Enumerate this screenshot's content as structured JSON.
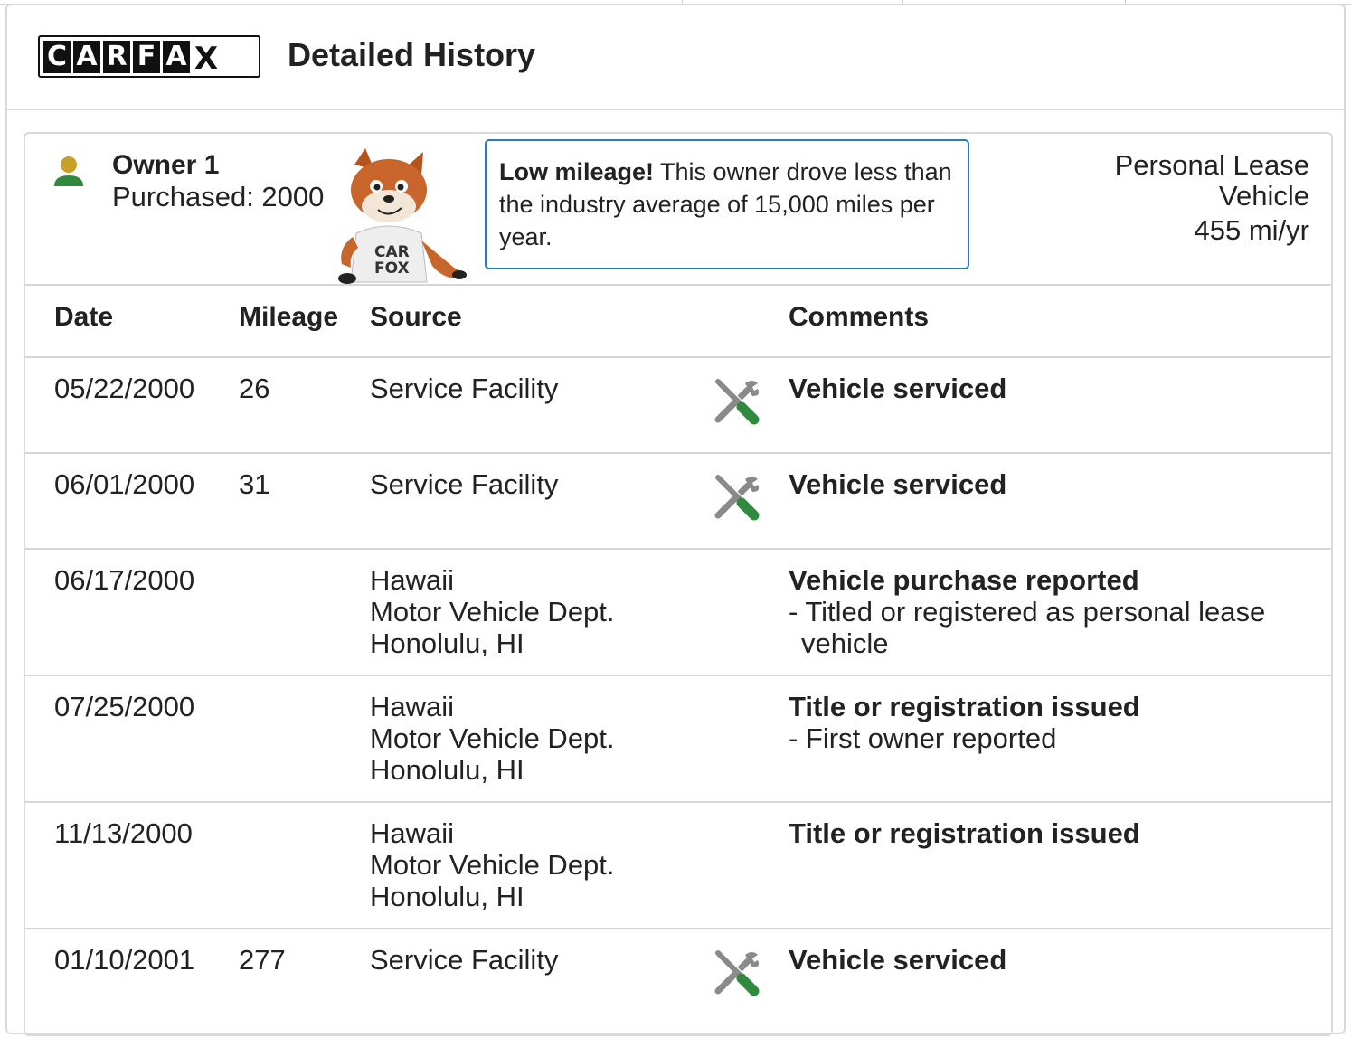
{
  "header": {
    "logo_letters": [
      "C",
      "A",
      "R",
      "F",
      "A",
      "X"
    ],
    "title": "Detailed History"
  },
  "owner": {
    "name": "Owner 1",
    "purchased": "Purchased: 2000",
    "callout_bold": "Low mileage!",
    "callout_text": " This owner drove less than the industry average of 15,000 miles per year.",
    "usage_type": "Personal Lease Vehicle",
    "miles_per_year": "455 mi/yr"
  },
  "table": {
    "columns": [
      "Date",
      "Mileage",
      "Source",
      "Comments"
    ],
    "rows": [
      {
        "date": "05/22/2000",
        "mileage": "26",
        "source": [
          "Service Facility"
        ],
        "icon": "service-wrench-icon",
        "comment_title": "Vehicle serviced",
        "comment_lines": []
      },
      {
        "date": "06/01/2000",
        "mileage": "31",
        "source": [
          "Service Facility"
        ],
        "icon": "service-wrench-icon",
        "comment_title": "Vehicle serviced",
        "comment_lines": []
      },
      {
        "date": "06/17/2000",
        "mileage": "",
        "source": [
          "Hawaii",
          "Motor Vehicle Dept.",
          "Honolulu, HI"
        ],
        "icon": "",
        "comment_title": "Vehicle purchase reported",
        "comment_lines": [
          "- Titled or registered as personal lease vehicle"
        ]
      },
      {
        "date": "07/25/2000",
        "mileage": "",
        "source": [
          "Hawaii",
          "Motor Vehicle Dept.",
          "Honolulu, HI"
        ],
        "icon": "",
        "comment_title": "Title or registration issued",
        "comment_lines": [
          "- First owner reported"
        ]
      },
      {
        "date": "11/13/2000",
        "mileage": "",
        "source": [
          "Hawaii",
          "Motor Vehicle Dept.",
          "Honolulu, HI"
        ],
        "icon": "",
        "comment_title": "Title or registration issued",
        "comment_lines": []
      },
      {
        "date": "01/10/2001",
        "mileage": "277",
        "source": [
          "Service Facility"
        ],
        "icon": "service-wrench-icon",
        "comment_title": "Vehicle serviced",
        "comment_lines": []
      }
    ]
  },
  "colors": {
    "accent_blue": "#2a78c6",
    "owner_icon_head": "#c8a028",
    "owner_icon_body": "#2e8b3e",
    "tool_gray": "#8a8a8a",
    "tool_green": "#2e8b3e"
  }
}
